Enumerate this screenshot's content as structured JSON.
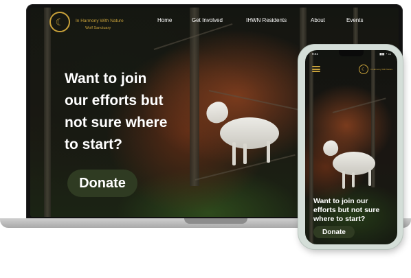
{
  "site": {
    "brand_name": "In Harmony With Nature",
    "brand_subtitle": "Wolf Sanctuary",
    "nav": [
      {
        "label": "Home"
      },
      {
        "label": "Get Involved"
      },
      {
        "label": "IHWN Residents"
      },
      {
        "label": "About"
      },
      {
        "label": "Events"
      }
    ],
    "hero_lines": [
      "Want to join",
      "our efforts but",
      "not sure where",
      "to start?"
    ],
    "donate_label": "Donate",
    "logo_icon": "wolf-logo-icon"
  },
  "mobile": {
    "status_time": "9:41",
    "status_icons": "▮▮▮ ◔ ▭",
    "hero_lines": [
      "Want to join our",
      "efforts but not sure",
      "where to start?"
    ],
    "donate_label": "Donate",
    "brand_name": "In Harmony With Nature",
    "menu_icon": "hamburger-menu-icon"
  },
  "colors": {
    "gold": "#c8a13a",
    "button_green": "#2f3b22",
    "text": "#ffffff"
  }
}
